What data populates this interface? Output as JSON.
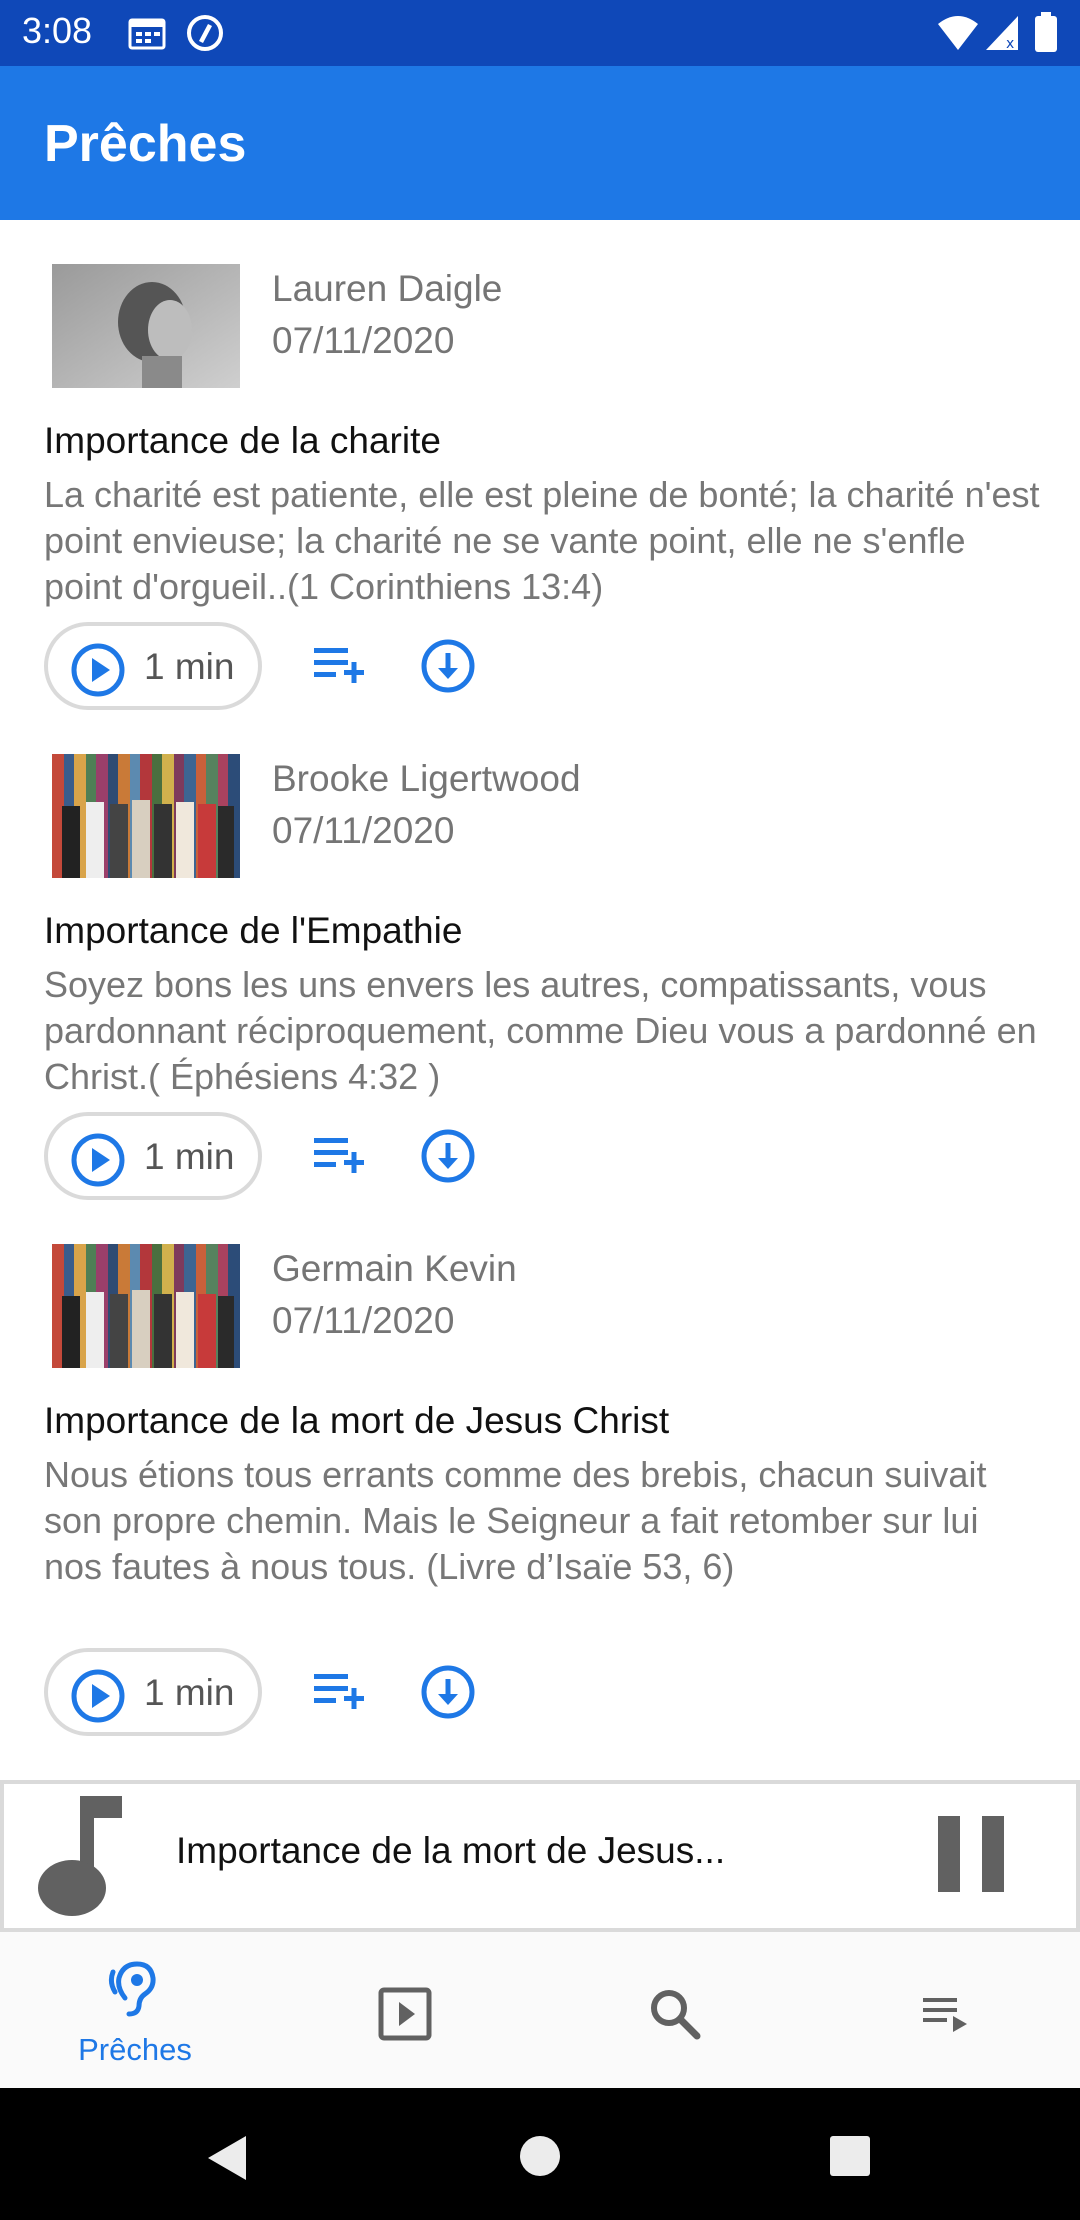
{
  "status_bar": {
    "time": "3:08"
  },
  "app_bar": {
    "title": "Prêches"
  },
  "sermons": [
    {
      "author": "Lauren Daigle",
      "date": "07/11/2020",
      "title": "Importance de la charite",
      "description": "La charité est patiente, elle est pleine de bonté; la charité n'est point envieuse; la charité ne se vante point, elle ne s'enfle point d'orgueil..(1 Corinthiens 13:4)",
      "duration": "1 min"
    },
    {
      "author": "Brooke Ligertwood",
      "date": "07/11/2020",
      "title": "Importance de l'Empathie",
      "description": "Soyez bons les uns envers les autres, compatissants, vous pardonnant réciproquement, comme Dieu vous a pardonné en Christ.( Éphésiens 4:32 )",
      "duration": "1 min"
    },
    {
      "author": "Germain Kevin",
      "date": "07/11/2020",
      "title": "Importance de la mort de Jesus Christ",
      "description": "Nous étions tous errants comme des brebis, chacun suivait son propre chemin. Mais le Seigneur a fait retomber sur lui nos fautes à nous tous. (Livre d’Isaïe 53, 6)",
      "duration": "1 min"
    }
  ],
  "mini_player": {
    "title": "Importance de la mort de Jesus..."
  },
  "bottom_nav": {
    "items": [
      {
        "label": "Prêches",
        "icon": "hearing-icon",
        "active": true
      },
      {
        "label": "",
        "icon": "play-box-icon"
      },
      {
        "label": "",
        "icon": "search-icon"
      },
      {
        "label": "",
        "icon": "queue-icon"
      }
    ]
  },
  "colors": {
    "status_bar": "#0f48b8",
    "app_bar": "#1e78e6",
    "accent": "#1e78e6",
    "secondary_text": "#777777"
  }
}
